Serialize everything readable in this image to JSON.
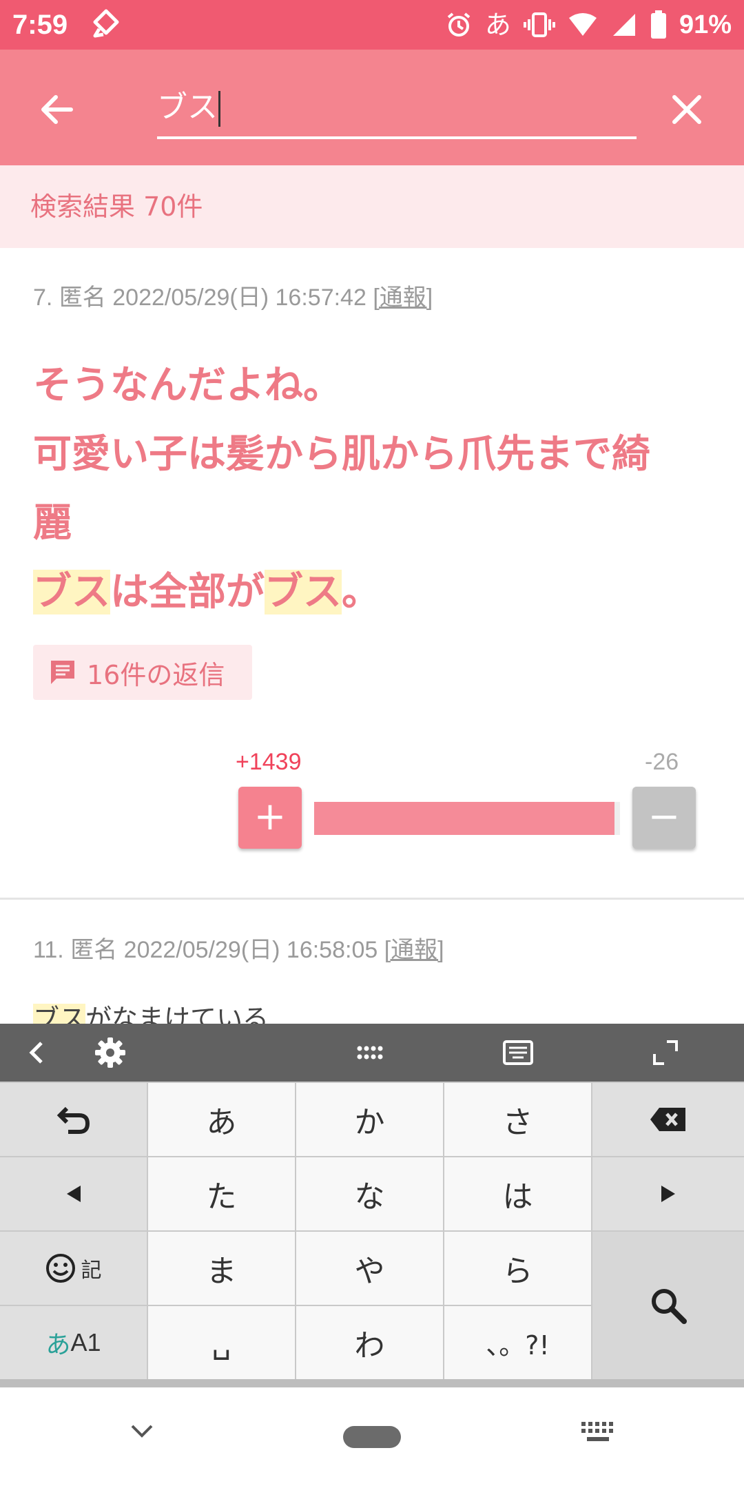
{
  "status_bar": {
    "time": "7:59",
    "ime_indicator": "あ",
    "battery": "91%",
    "icons": [
      "app-notification-icon",
      "alarm-icon",
      "vibrate-icon",
      "wifi-icon",
      "signal-icon",
      "battery-icon"
    ]
  },
  "search": {
    "query": "ブス",
    "back_icon": "arrow-left-icon",
    "clear_icon": "close-icon"
  },
  "results": {
    "count_label": "検索結果 70件"
  },
  "comments": [
    {
      "number": "7.",
      "name": "匿名",
      "datetime": "2022/05/29(日) 16:57:42",
      "report": "[通報]",
      "lines": [
        [
          {
            "text": "そうなんだよね。",
            "hl": false
          }
        ],
        [
          {
            "text": "可愛い子は髪から肌から爪先まで綺",
            "hl": false
          }
        ],
        [
          {
            "text": "麗",
            "hl": false
          }
        ],
        [
          {
            "text": "ブス",
            "hl": true
          },
          {
            "text": "は全部が",
            "hl": false
          },
          {
            "text": "ブス",
            "hl": true
          },
          {
            "text": "。",
            "hl": false
          }
        ]
      ],
      "reply_label": "16件の返信",
      "plus_count": "+1439",
      "minus_count": "-26",
      "plus_label": "+",
      "minus_label": "−",
      "plus_ratio": 0.982
    },
    {
      "number": "11.",
      "name": "匿名",
      "datetime": "2022/05/29(日) 16:58:05",
      "report": "[通報]",
      "lines": [
        [
          {
            "text": "ブス",
            "hl": true
          },
          {
            "text": "がなまけている",
            "hl": false
          }
        ]
      ]
    }
  ],
  "keyboard": {
    "toolbar_icons": [
      "chevron-left-icon",
      "settings-icon",
      "dots-grid-icon",
      "keyboard-layout-icon",
      "expand-icon"
    ],
    "rows": [
      {
        "left": "undo-icon",
        "keys": [
          "あ",
          "か",
          "さ"
        ],
        "right": "backspace-icon"
      },
      {
        "left": "cursor-left-icon",
        "keys": [
          "た",
          "な",
          "は"
        ],
        "right": "cursor-right-icon"
      },
      {
        "left_label": "記",
        "keys": [
          "ま",
          "や",
          "ら"
        ]
      },
      {
        "left_label_kana": "あ",
        "left_label_alpha": "A1",
        "keys": [
          "␣",
          "わ",
          "、。?!"
        ]
      }
    ],
    "search_icon": "search-icon"
  },
  "nav_bar": {
    "icons": [
      "nav-hide-keyboard-icon",
      "home-pill",
      "keyboard-switch-icon"
    ]
  }
}
